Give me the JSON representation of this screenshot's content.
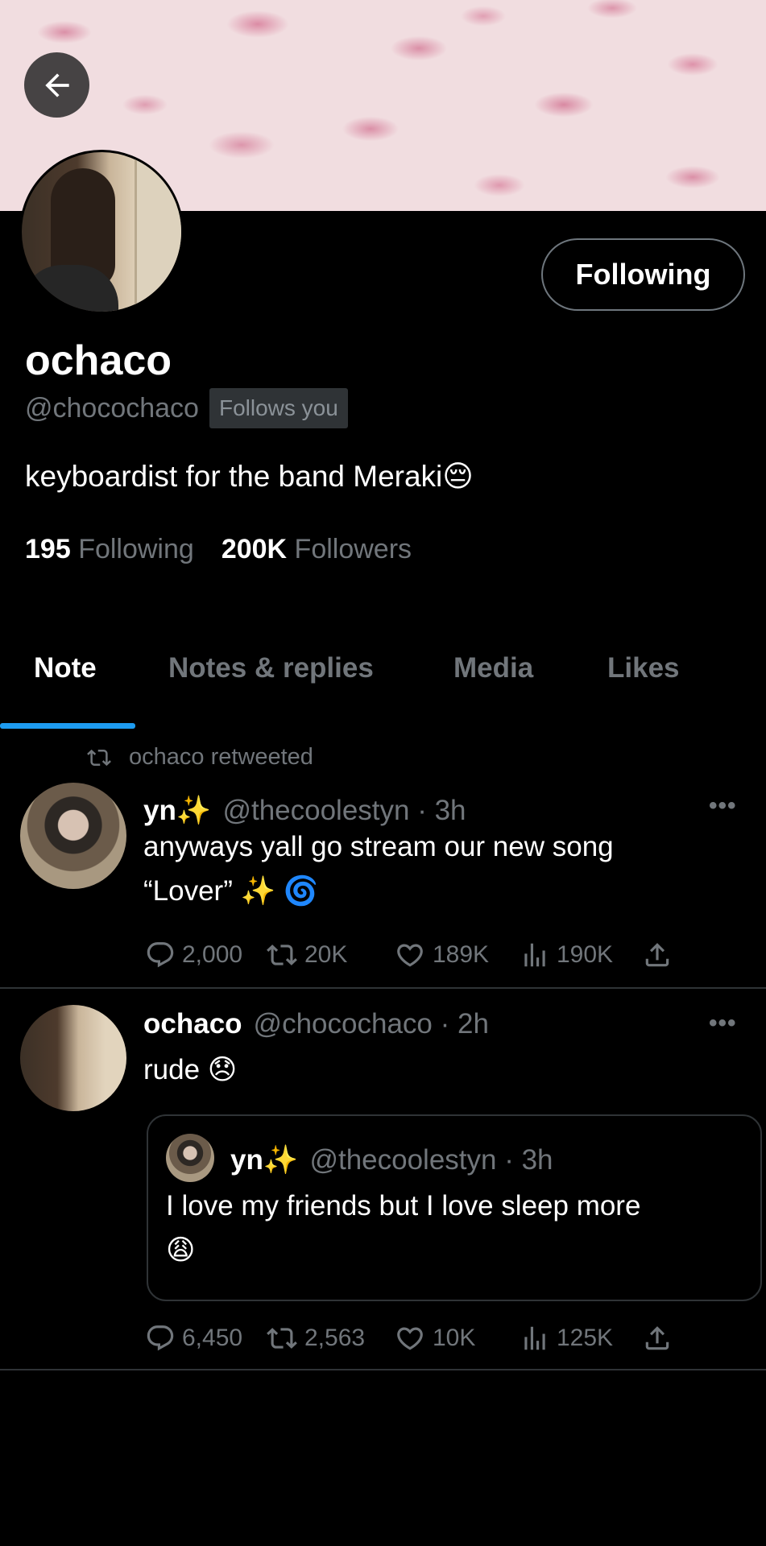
{
  "profile": {
    "display_name": "ochaco",
    "handle": "@chocochaco",
    "follows_you": "Follows you",
    "bio": "keyboardist for the band Meraki😔",
    "following_count": "195",
    "following_label": "Following",
    "followers_count": "200K",
    "followers_label": "Followers",
    "follow_button": "Following"
  },
  "tabs": [
    {
      "label": "Note",
      "active": true
    },
    {
      "label": "Notes & replies",
      "active": false
    },
    {
      "label": "Media",
      "active": false
    },
    {
      "label": "Likes",
      "active": false
    }
  ],
  "tweets": [
    {
      "retweeted_by": "ochaco retweeted",
      "name": "yn✨",
      "meta": "@thecoolestyn · 3h",
      "text_line1": "anyways yall go stream our new song",
      "text_line2": "“Lover” ✨ 🌀",
      "replies": "2,000",
      "retweets": "20K",
      "likes": "189K",
      "views": "190K"
    },
    {
      "name": "ochaco",
      "meta": "@chocochaco · 2h",
      "text": "rude 😞",
      "quote": {
        "name": "yn✨",
        "meta": "@thecoolestyn · 3h",
        "text_line1": "I love my friends but I love sleep more",
        "text_line2": "😩"
      },
      "replies": "6,450",
      "retweets": "2,563",
      "likes": "10K",
      "views": "125K"
    }
  ],
  "colors": {
    "accent": "#1d9bf0",
    "muted": "#71767b",
    "border": "#2f3336",
    "background": "#000000"
  }
}
